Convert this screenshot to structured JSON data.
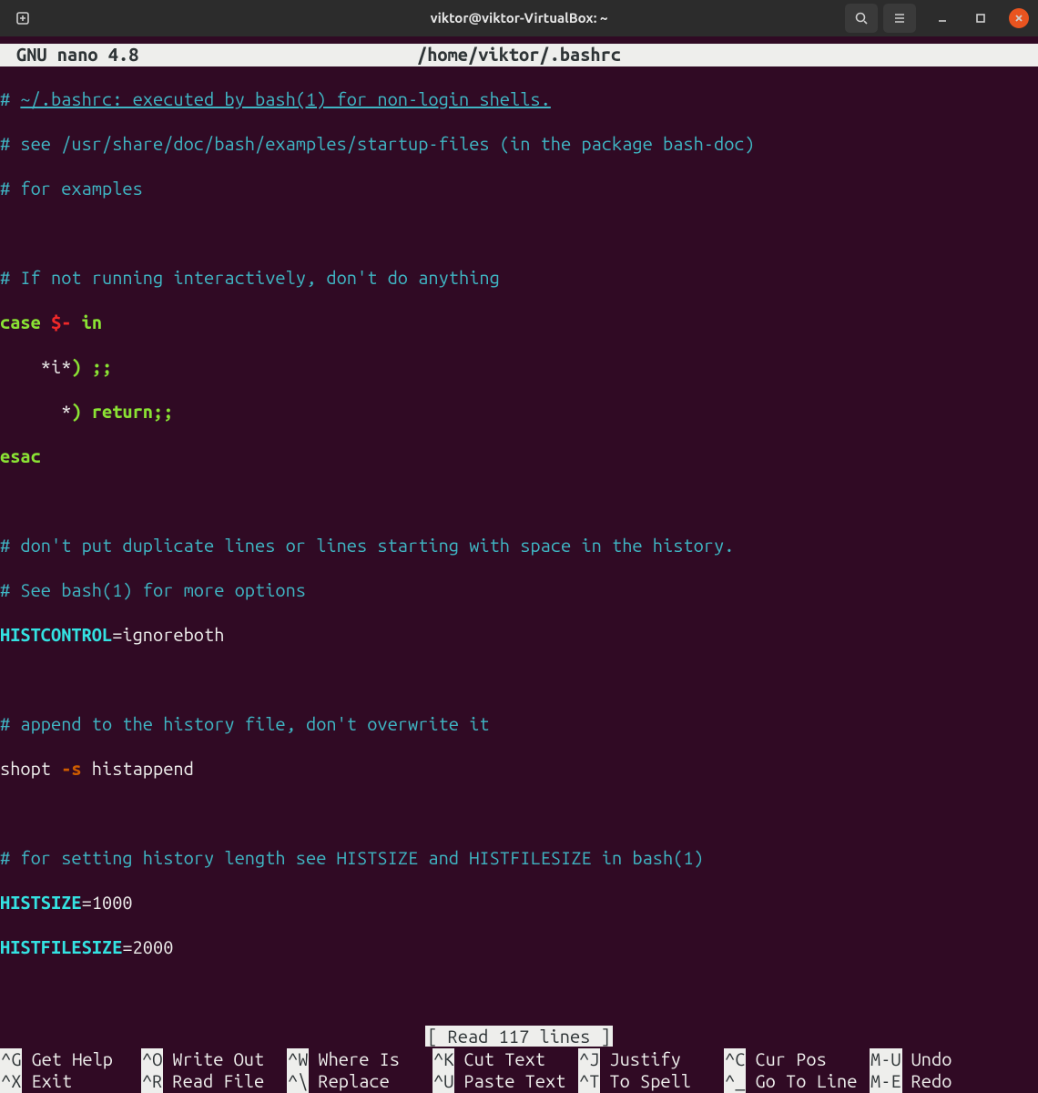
{
  "titlebar": {
    "title": "viktor@viktor-VirtualBox: ~"
  },
  "nano": {
    "app_label": "GNU nano 4.8",
    "file_path": "/home/viktor/.bashrc",
    "status": "[ Read 117 lines ]"
  },
  "content": {
    "l1_pre": "# ",
    "l1_txt": "~/.bashrc: executed by bash(1) for non-login shells.",
    "l2": "# see /usr/share/doc/bash/examples/startup-files (in the package bash-doc)",
    "l3": "# for examples",
    "l4": "",
    "l5": "# If not running interactively, don't do anything",
    "l6_case": "case",
    "l6_dollar": "$-",
    "l6_in": " in",
    "l7_pat": "    *i*",
    "l7_par": ")",
    "l7_semi": " ;;",
    "l8_pat": "      *",
    "l8_par": ")",
    "l8_ret": " return",
    "l8_semi": ";;",
    "l9": "esac",
    "l10": "",
    "l11": "# don't put duplicate lines or lines starting with space in the history.",
    "l12": "# See bash(1) for more options",
    "l13_var": "HISTCONTROL",
    "l13_eq": "=",
    "l13_val": "ignoreboth",
    "l14": "",
    "l15": "# append to the history file, don't overwrite it",
    "l16_cmd": "shopt",
    "l16_flag": " -s",
    "l16_arg": " histappend",
    "l17": "",
    "l18": "# for setting history length see HISTSIZE and HISTFILESIZE in bash(1)",
    "l19_var": "HISTSIZE",
    "l19_eq": "=",
    "l19_val": "1000",
    "l20_var": "HISTFILESIZE",
    "l20_eq": "=",
    "l20_val": "2000"
  },
  "shortcuts": {
    "row1": [
      {
        "key": "^G",
        "label": "Get Help"
      },
      {
        "key": "^O",
        "label": "Write Out"
      },
      {
        "key": "^W",
        "label": "Where Is"
      },
      {
        "key": "^K",
        "label": "Cut Text"
      },
      {
        "key": "^J",
        "label": "Justify"
      },
      {
        "key": "^C",
        "label": "Cur Pos"
      },
      {
        "key": "M-U",
        "label": "Undo"
      }
    ],
    "row2": [
      {
        "key": "^X",
        "label": "Exit"
      },
      {
        "key": "^R",
        "label": "Read File"
      },
      {
        "key": "^\\",
        "label": "Replace"
      },
      {
        "key": "^U",
        "label": "Paste Text"
      },
      {
        "key": "^T",
        "label": "To Spell"
      },
      {
        "key": "^_",
        "label": "Go To Line"
      },
      {
        "key": "M-E",
        "label": "Redo"
      }
    ]
  }
}
